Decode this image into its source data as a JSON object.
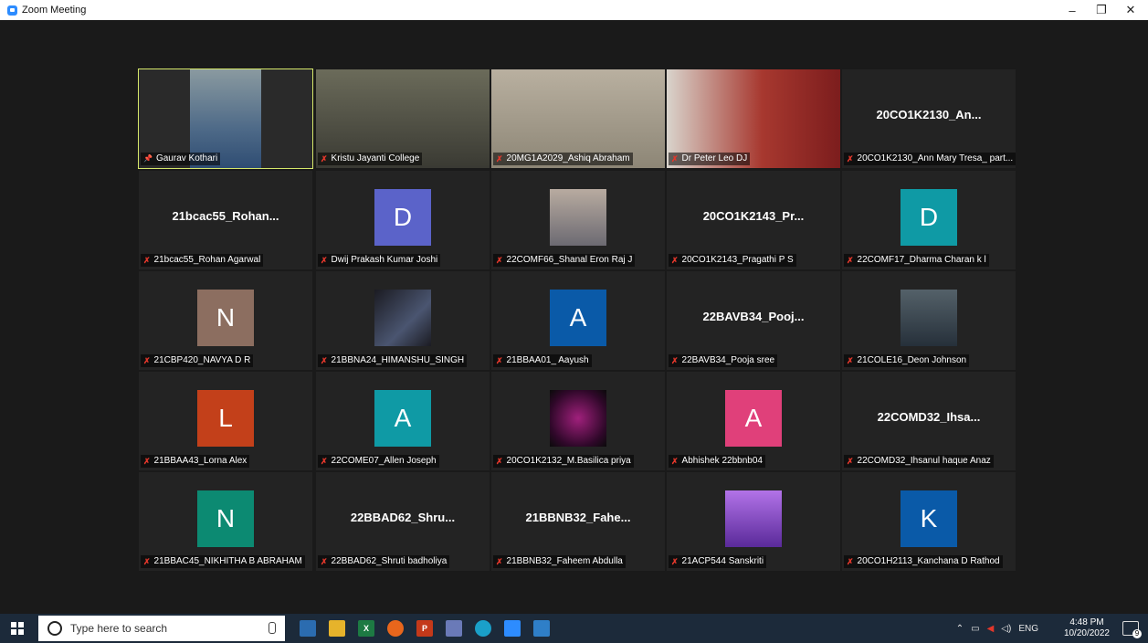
{
  "window": {
    "title": "Zoom Meeting",
    "controls": {
      "minimize": "–",
      "restore": "❐",
      "close": "✕"
    }
  },
  "participants": [
    {
      "label": "Gaurav Kothari",
      "type": "video",
      "active": true,
      "pinned": true
    },
    {
      "label": "Kristu Jayanti College",
      "type": "video"
    },
    {
      "label": "20MG1A2029_Ashiq Abraham",
      "type": "video"
    },
    {
      "label": "Dr Peter Leo DJ",
      "type": "video"
    },
    {
      "label": "20CO1K2130_Ann Mary Tresa_ part...",
      "type": "name",
      "display": "20CO1K2130_An..."
    },
    {
      "label": "21bcac55_Rohan Agarwal",
      "type": "name",
      "display": "21bcac55_Rohan..."
    },
    {
      "label": "Dwij Prakash Kumar Joshi",
      "type": "avatar",
      "letter": "D",
      "color": "#5b63c9"
    },
    {
      "label": "22COMF66_Shanal Eron Raj J",
      "type": "photo"
    },
    {
      "label": "20CO1K2143_Pragathi P S",
      "type": "name",
      "display": "20CO1K2143_Pr..."
    },
    {
      "label": "22COMF17_Dharma Charan k l",
      "type": "avatar",
      "letter": "D",
      "color": "#0f9aa5"
    },
    {
      "label": "21CBP420_NAVYA D R",
      "type": "avatar",
      "letter": "N",
      "color": "#8c6e60"
    },
    {
      "label": "21BBNA24_HIMANSHU_SINGH",
      "type": "photo"
    },
    {
      "label": "21BBAA01_ Aayush",
      "type": "avatar",
      "letter": "A",
      "color": "#0a5aa8"
    },
    {
      "label": "22BAVB34_Pooja sree",
      "type": "name",
      "display": "22BAVB34_Pooj..."
    },
    {
      "label": "21COLE16_Deon Johnson",
      "type": "photo"
    },
    {
      "label": "21BBAA43_Lorna Alex",
      "type": "avatar",
      "letter": "L",
      "color": "#c3401a"
    },
    {
      "label": "22COME07_Allen Joseph",
      "type": "avatar",
      "letter": "A",
      "color": "#0f9aa5"
    },
    {
      "label": "20CO1K2132_M.Basilica priya",
      "type": "photo"
    },
    {
      "label": "Abhishek 22bbnb04",
      "type": "avatar",
      "letter": "A",
      "color": "#e0407a"
    },
    {
      "label": "22COMD32_Ihsanul haque Anaz",
      "type": "name",
      "display": "22COMD32_Ihsa..."
    },
    {
      "label": "21BBAC45_NIKHITHA B ABRAHAM",
      "type": "avatar",
      "letter": "N",
      "color": "#0c8a72"
    },
    {
      "label": "22BBAD62_Shruti badholiya",
      "type": "name",
      "display": "22BBAD62_Shru..."
    },
    {
      "label": "21BBNB32_Faheem Abdulla",
      "type": "name",
      "display": "21BBNB32_Fahe..."
    },
    {
      "label": "21ACP544 Sanskriti",
      "type": "photo"
    },
    {
      "label": "20CO1H2113_Kanchana D Rathod",
      "type": "avatar",
      "letter": "K",
      "color": "#0a5aa8"
    }
  ],
  "taskbar": {
    "search_placeholder": "Type here to search",
    "language": "ENG",
    "time": "4:48 PM",
    "date": "10/20/2022",
    "notification_count": "9"
  }
}
